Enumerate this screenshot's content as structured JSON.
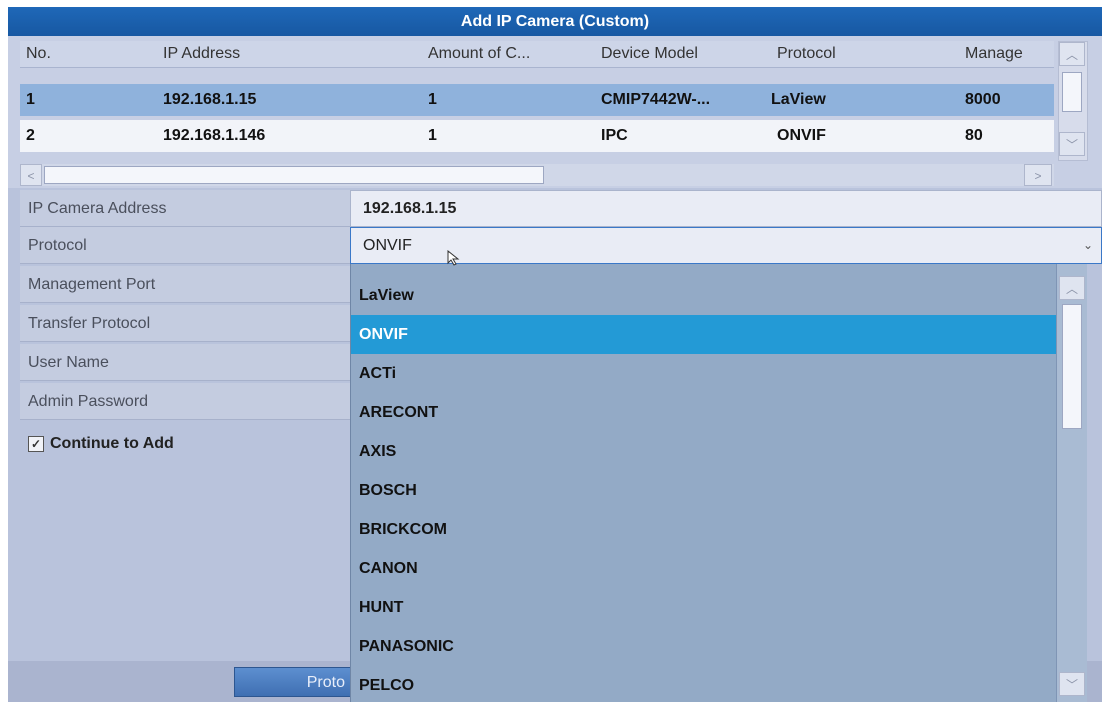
{
  "window": {
    "title": "Add IP Camera (Custom)"
  },
  "table": {
    "headers": [
      "No.",
      "IP Address",
      "Amount of C...",
      "Device Model",
      "Protocol",
      "Manage"
    ],
    "rows": [
      [
        "1",
        "192.168.1.15",
        "1",
        "CMIP7442W-...",
        "LaView",
        "8000"
      ],
      [
        "2",
        "192.168.1.146",
        "1",
        "IPC",
        "ONVIF",
        "80"
      ]
    ],
    "selected_row": 0,
    "scroll_up_icon": "chevron-up-icon",
    "scroll_down_icon": "chevron-down-icon",
    "scroll_left_icon": "chevron-left-icon",
    "scroll_right_icon": "chevron-right-icon",
    "up_glyph": "︿",
    "down_glyph": "﹀",
    "left_glyph": "<",
    "right_glyph": ">"
  },
  "form": {
    "ip_address_label": "IP Camera Address",
    "ip_address_value": "192.168.1.15",
    "protocol_label": "Protocol",
    "protocol_value": "ONVIF",
    "management_port_label": "Management Port",
    "transfer_protocol_label": "Transfer Protocol",
    "user_name_label": "User Name",
    "admin_password_label": "Admin Password",
    "continue_label": "Continue to Add",
    "continue_checked": true,
    "check_glyph": "✓",
    "caret_glyph": "⌄"
  },
  "dropdown": {
    "options": [
      "LaView",
      "ONVIF",
      "ACTi",
      "ARECONT",
      "AXIS",
      "BOSCH",
      "BRICKCOM",
      "CANON",
      "HUNT",
      "PANASONIC",
      "PELCO"
    ],
    "selected_index": 1
  },
  "bottom": {
    "button_label": "Proto"
  },
  "colors": {
    "title_bar": "#1f68b8",
    "selected_row": "#8fb2dc",
    "dropdown_selected": "#239ad6",
    "dropdown_bg": "#93aac6"
  }
}
